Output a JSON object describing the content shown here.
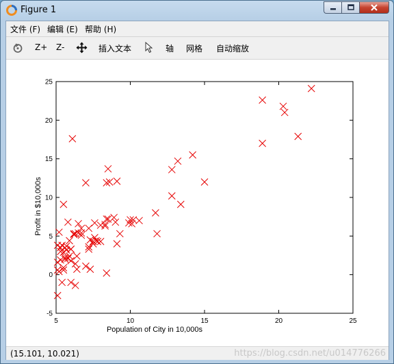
{
  "window": {
    "title": "Figure 1"
  },
  "menu": [
    {
      "label": "文件 (F)"
    },
    {
      "label": "编辑 (E)"
    },
    {
      "label": "帮助 (H)"
    }
  ],
  "toolbar": {
    "zoom_in": "Z+",
    "zoom_out": "Z-",
    "insert_text": "插入文本",
    "axes": "轴",
    "grid": "网格",
    "autoscale": "自动缩放"
  },
  "status": {
    "coords": "(15.101, 10.021)",
    "watermark": "https://blog.csdn.net/u014776266"
  },
  "colors": {
    "marker": "#e60000",
    "accent": "#6fa3c9"
  },
  "chart_data": {
    "type": "scatter",
    "title": "",
    "xlabel": "Population of City in 10,000s",
    "ylabel": "Profit in $10,000s",
    "xlim": [
      5,
      25
    ],
    "ylim": [
      -5,
      25
    ],
    "xticks": [
      5,
      10,
      15,
      20,
      25
    ],
    "yticks": [
      -5,
      0,
      5,
      10,
      15,
      20,
      25
    ],
    "grid": false,
    "marker": "x",
    "x": [
      6.1,
      5.5,
      8.5,
      7.0,
      5.8,
      8.4,
      7.5,
      8.6,
      6.5,
      5.1,
      6.0,
      14.2,
      5.7,
      8.4,
      6.4,
      5.6,
      6.3,
      5.1,
      5.7,
      6.2,
      7.3,
      5.3,
      5.6,
      5.8,
      5.5,
      7.5,
      5.3,
      5.1,
      5.3,
      6.0,
      6.3,
      5.5,
      6.0,
      7.6,
      7.6,
      8.0,
      8.9,
      9.0,
      13.2,
      7.2,
      9.1,
      10.6,
      5.4,
      6.0,
      6.2,
      8.5,
      7.0,
      5.6,
      6.3,
      8.0,
      6.4,
      8.3,
      6.5,
      5.9,
      5.4,
      5.1,
      10.1,
      6.7,
      7.3,
      5.2,
      5.2,
      6.7,
      5.9,
      7.2,
      18.9,
      20.3,
      20.4,
      18.9,
      22.2,
      21.3,
      12.8,
      13.4,
      12.8,
      10.0,
      15.0,
      9.9,
      11.7,
      8.4,
      11.8,
      9.1,
      8.3,
      10.2,
      5.5,
      7.7,
      6.7,
      7.8,
      7.2,
      9.3
    ],
    "y": [
      17.6,
      9.1,
      13.7,
      11.9,
      6.8,
      11.9,
      4.3,
      12.0,
      6.6,
      3.8,
      3.3,
      15.5,
      3.2,
      7.2,
      0.7,
      3.5,
      5.3,
      0.6,
      3.7,
      5.3,
      0.7,
      3.5,
      2.2,
      2.1,
      2.9,
      4.0,
      1.9,
      1.6,
      3.0,
      1.8,
      1.4,
      0.9,
      -1.0,
      4.8,
      6.7,
      6.4,
      7.4,
      6.8,
      14.7,
      6.0,
      12.1,
      7.0,
      3.8,
      3.3,
      5.2,
      7.2,
      1.1,
      2.0,
      -1.4,
      4.3,
      2.4,
      6.5,
      5.4,
      2.4,
      -1.0,
      -2.7,
      6.6,
      6.0,
      4.5,
      5.5,
      0.4,
      5.1,
      4.4,
      3.6,
      22.6,
      21.8,
      21.0,
      17.0,
      24.1,
      17.9,
      13.6,
      9.1,
      10.2,
      7.1,
      12.0,
      6.7,
      8.0,
      0.2,
      5.3,
      4.0,
      6.3,
      7.1,
      0.6,
      4.4,
      5.4,
      4.3,
      3.3,
      5.3
    ]
  }
}
